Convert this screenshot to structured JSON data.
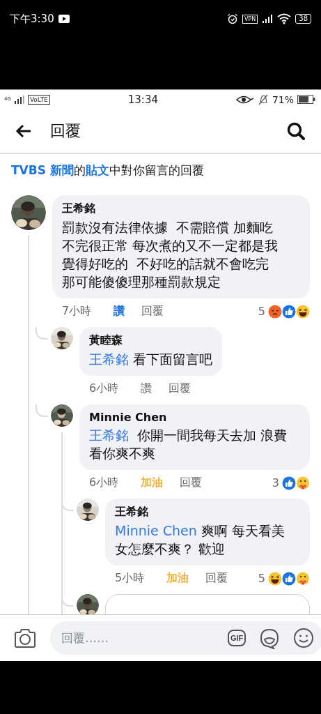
{
  "system_status": {
    "time": "下午3:30",
    "vpn": "VPN",
    "battery": "38"
  },
  "device_status": {
    "network": "4G",
    "volte": "VoLTE",
    "time": "13:34",
    "battery": "71%"
  },
  "header": {
    "title": "回覆"
  },
  "context": [
    {
      "text": "TVBS 新聞",
      "kind": "link"
    },
    {
      "text": "的",
      "kind": "text"
    },
    {
      "text": "貼文",
      "kind": "link"
    },
    {
      "text": "中對你留言的回覆",
      "kind": "text"
    }
  ],
  "comments": [
    {
      "author": "王希銘",
      "text": "罰款沒有法律依據  不需賠償 加麵吃不完很正常 每次煮的又不一定都是我覺得好吃的  不好吃的話就不會吃完那可能傻傻理那種罰款規定",
      "time": "7小時",
      "react_label": "讚",
      "reacted": true,
      "color": "#1b74e4",
      "reply_label": "回覆",
      "count": "5",
      "reactions": [
        {
          "kind": "angry"
        },
        {
          "kind": "like"
        },
        {
          "kind": "haha"
        }
      ],
      "children": [
        {
          "author": "黃睦森",
          "mention": "王希銘",
          "text": "看下面留言吧",
          "time": "6小時",
          "react_label": "讚",
          "reacted": false,
          "reply_label": "回覆"
        },
        {
          "author": "Minnie Chen",
          "mention": "王希銘",
          "text": " 你開一間我每天去加 浪費看你爽不爽",
          "time": "6小時",
          "react_label": "加油",
          "reacted": true,
          "color": "#f0b13b",
          "reply_label": "回覆",
          "count": "3",
          "reactions": [
            {
              "kind": "like"
            },
            {
              "kind": "care"
            }
          ],
          "reply_box": true,
          "children": [
            {
              "author": "王希銘",
              "mention": "Minnie Chen",
              "text": "爽啊 每天看美女怎麼不爽？ 歡迎",
              "time": "5小時",
              "react_label": "加油",
              "reacted": true,
              "color": "#f0b13b",
              "reply_label": "回覆",
              "count": "5",
              "reactions": [
                {
                  "kind": "haha"
                },
                {
                  "kind": "like"
                },
                {
                  "kind": "care"
                }
              ]
            }
          ]
        }
      ]
    }
  ],
  "composer": {
    "placeholder": "回覆……",
    "gif": "GIF"
  }
}
